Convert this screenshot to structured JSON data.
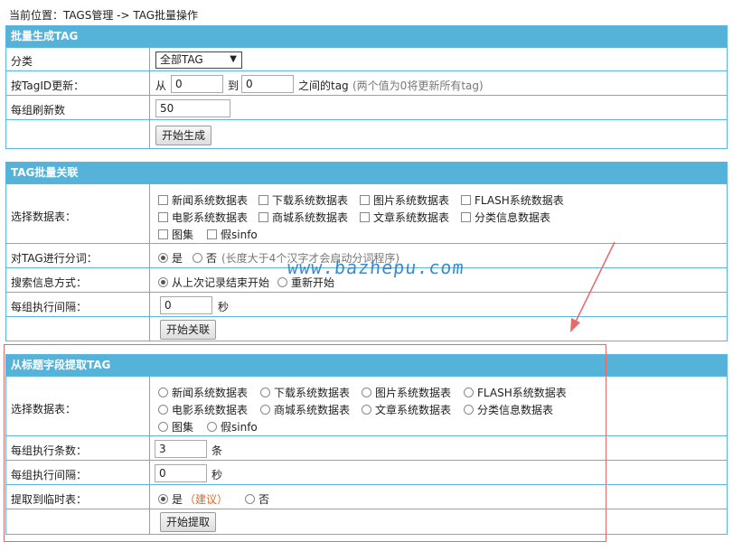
{
  "breadcrumb": "当前位置：TAGS管理 -> TAG批量操作",
  "sec1": {
    "title": "批量生成TAG",
    "category_label": "分类",
    "category_value": "全部TAG",
    "update_label": "按TagID更新：",
    "from_text": "从",
    "from_value": "0",
    "to_text": "到",
    "to_value": "0",
    "between_text": "之间的tag",
    "hint": "(两个值为0将更新所有tag)",
    "refresh_label": "每组刷新数",
    "refresh_value": "50",
    "start_button": "开始生成"
  },
  "sec2": {
    "title": "TAG批量关联",
    "table_label": "选择数据表：",
    "tables": [
      "新闻系统数据表",
      "下载系统数据表",
      "图片系统数据表",
      "FLASH系统数据表",
      "电影系统数据表",
      "商城系统数据表",
      "文章系统数据表",
      "分类信息数据表",
      "图集",
      "假sinfo"
    ],
    "split_label": "对TAG进行分词：",
    "split_yes": "是",
    "split_no": "否",
    "split_hint": "(长度大于4个汉字才会启动分词程序)",
    "search_label": "搜索信息方式：",
    "search_opt1": "从上次记录结束开始",
    "search_opt2": "重新开始",
    "interval_label": "每组执行间隔：",
    "interval_value": "0",
    "interval_unit": "秒",
    "start_button": "开始关联"
  },
  "sec3": {
    "title": "从标题字段提取TAG",
    "table_label": "选择数据表：",
    "tables": [
      "新闻系统数据表",
      "下载系统数据表",
      "图片系统数据表",
      "FLASH系统数据表",
      "电影系统数据表",
      "商城系统数据表",
      "文章系统数据表",
      "分类信息数据表",
      "图集",
      "假sinfo"
    ],
    "count_label": "每组执行条数：",
    "count_value": "3",
    "count_unit": "条",
    "interval_label": "每组执行间隔：",
    "interval_value": "0",
    "interval_unit": "秒",
    "temp_label": "提取到临时表：",
    "temp_yes": "是",
    "temp_suggest": "（建议）",
    "temp_no": "否",
    "start_button": "开始提取"
  },
  "watermark": "www.bazhepu.com",
  "colors": {
    "header": "#55b3da",
    "border": "#5ab6dc",
    "annotation": "#e66a6a",
    "watermark": "#2b7ec9",
    "suggest": "#e2691e"
  }
}
